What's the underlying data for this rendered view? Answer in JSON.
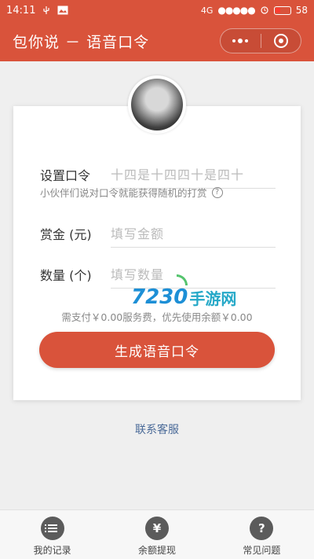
{
  "status_bar": {
    "time": "14:11",
    "network": "4G",
    "battery": "58"
  },
  "header": {
    "title": "包你说 － 语音口令"
  },
  "form": {
    "password_label": "设置口令",
    "password_placeholder": "十四是十四四十是四十",
    "hint": "小伙伴们说对口令就能获得随机的打赏",
    "reward_label": "赏金 (元)",
    "reward_placeholder": "填写金额",
    "count_label": "数量 (个)",
    "count_placeholder": "填写数量",
    "fee_text": "需支付￥0.00服务费，优先使用余额￥0.00",
    "submit_label": "生成语音口令"
  },
  "watermark": {
    "number": "7230",
    "text": "手游网"
  },
  "contact_label": "联系客服",
  "tabs": [
    {
      "label": "我的记录",
      "icon": "list-icon"
    },
    {
      "label": "余额提现",
      "icon": "yuan-icon",
      "glyph": "¥"
    },
    {
      "label": "常见问题",
      "icon": "question-icon",
      "glyph": "?"
    }
  ],
  "colors": {
    "brand": "#d9533b",
    "link": "#4a6a98"
  }
}
